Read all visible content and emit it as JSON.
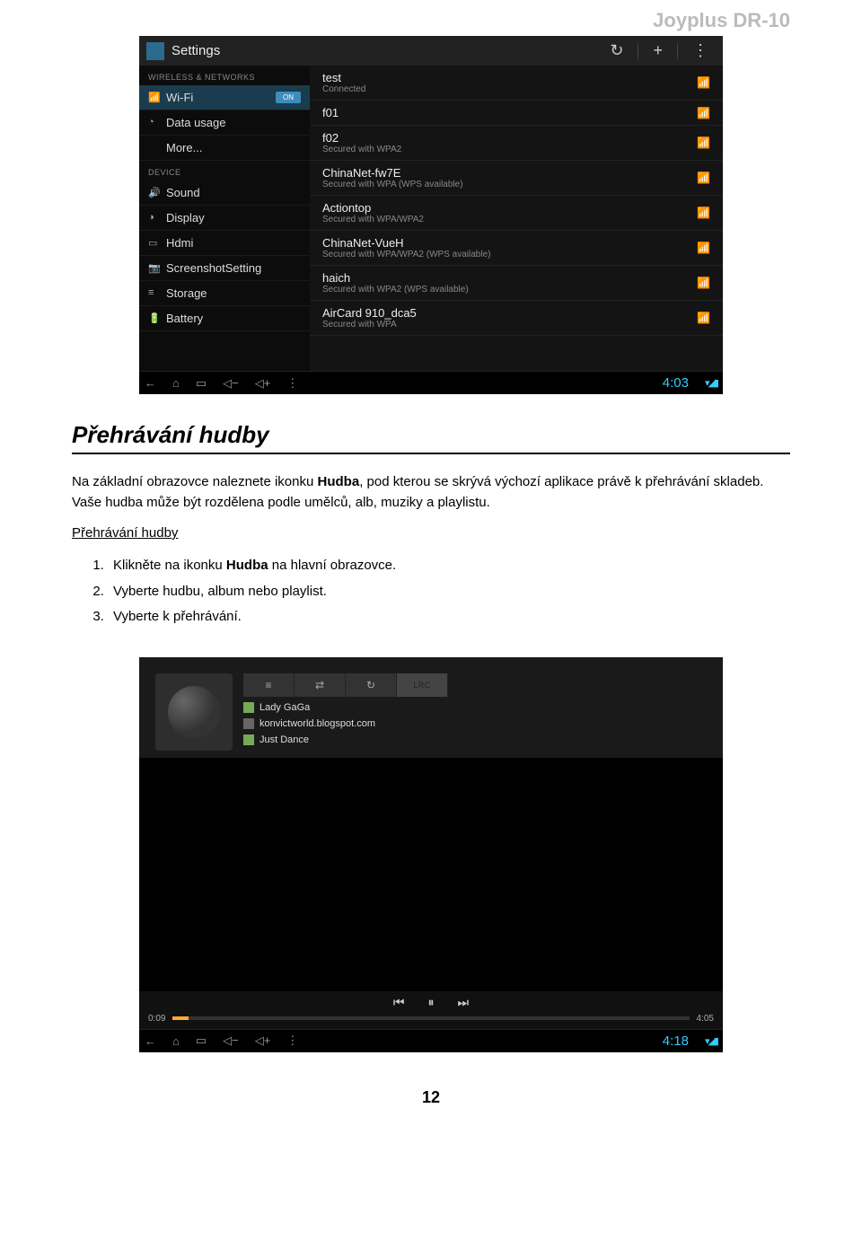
{
  "brand": "Joyplus DR-10",
  "settings_screenshot": {
    "title": "Settings",
    "header_buttons": {
      "refresh": "↻",
      "add": "+",
      "menu": "⋮"
    },
    "sidebar": {
      "section1": "WIRELESS & NETWORKS",
      "wifi": "Wi-Fi",
      "wifi_toggle": "ON",
      "data_usage": "Data usage",
      "more": "More...",
      "section2": "DEVICE",
      "sound": "Sound",
      "display": "Display",
      "hdmi": "Hdmi",
      "screenshot": "ScreenshotSetting",
      "storage": "Storage",
      "battery": "Battery"
    },
    "networks": [
      {
        "name": "test",
        "sub": "Connected"
      },
      {
        "name": "f01",
        "sub": ""
      },
      {
        "name": "f02",
        "sub": "Secured with WPA2"
      },
      {
        "name": "ChinaNet-fw7E",
        "sub": "Secured with WPA (WPS available)"
      },
      {
        "name": "Actiontop",
        "sub": "Secured with WPA/WPA2"
      },
      {
        "name": "ChinaNet-VueH",
        "sub": "Secured with WPA/WPA2 (WPS available)"
      },
      {
        "name": "haich",
        "sub": "Secured with WPA2 (WPS available)"
      },
      {
        "name": "AirCard 910_dca5",
        "sub": "Secured with WPA"
      }
    ],
    "navbar": {
      "back": "←",
      "home": "⌂",
      "recents": "▭",
      "voldown": "◁−",
      "volup": "◁+",
      "more": "⋮"
    },
    "status_time": "4:03",
    "status_icons": "▾◢▮"
  },
  "doc": {
    "heading": "Přehrávání hudby",
    "para1_pre": "Na základní obrazovce naleznete ikonku ",
    "para1_bold": "Hudba",
    "para1_post": ", pod kterou se skrývá výchozí aplikace právě k přehrávání skladeb. Vaše hudba může být rozdělena podle umělců, alb, muziky a playlistu.",
    "subhead": "Přehrávání hudby",
    "li1_pre": "Klikněte na ikonku ",
    "li1_bold": "Hudba",
    "li1_post": " na hlavní obrazovce.",
    "li2": "Vyberte hudbu, album nebo playlist.",
    "li3": "Vyberte k přehrávání."
  },
  "music_screenshot": {
    "tabs": {
      "list": "≡",
      "shuffle": "⇄",
      "repeat": "↻",
      "lrc": "LRC"
    },
    "artist": "Lady GaGa",
    "album": "konvictworld.blogspot.com",
    "song": "Just Dance",
    "controls": {
      "prev": "⏮",
      "pause": "⏸",
      "next": "⏭"
    },
    "progress": {
      "current": "0:09",
      "total": "4:05"
    },
    "navbar": {
      "back": "←",
      "home": "⌂",
      "recents": "▭",
      "voldown": "◁−",
      "volup": "◁+",
      "more": "⋮"
    },
    "status_time": "4:18",
    "status_icons": "▾◢▮"
  },
  "page_number": "12"
}
